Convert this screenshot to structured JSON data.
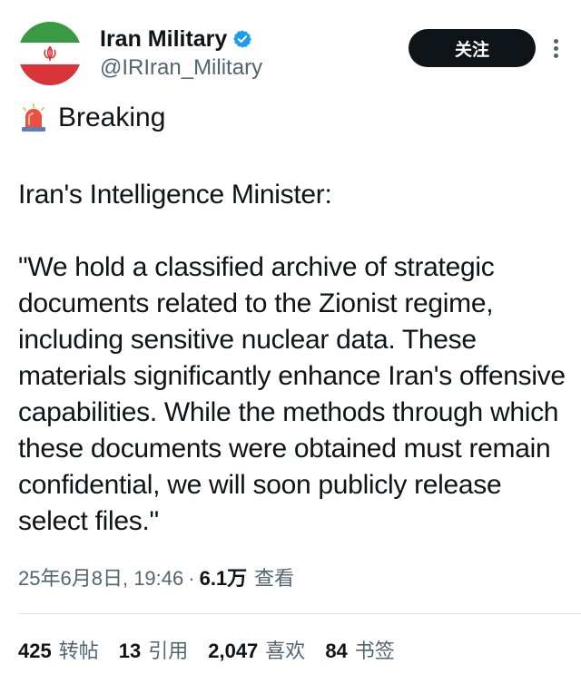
{
  "author": {
    "display_name": "Iran Military",
    "handle": "@IRIran_Military",
    "verified": true,
    "avatar_icon": "iran-flag-avatar"
  },
  "follow_label": "关注",
  "tag": {
    "icon": "rotating-light-icon",
    "text": "Breaking"
  },
  "body": {
    "intro": "Iran's Intelligence Minister:",
    "quote": "\"We hold a classified archive of strategic documents related to the Zionist regime, including sensitive nuclear data. These materials significantly enhance Iran's offensive capabilities. While the methods through which these documents were obtained must remain confidential, we will soon publicly release select files.\""
  },
  "meta": {
    "date": "25年6月8日",
    "time": "19:46",
    "separator": "·",
    "views": "6.1万",
    "views_label": "查看"
  },
  "stats": [
    {
      "num": "425",
      "label": "转帖"
    },
    {
      "num": "13",
      "label": "引用"
    },
    {
      "num": "2,047",
      "label": "喜欢"
    },
    {
      "num": "84",
      "label": "书签"
    }
  ],
  "colors": {
    "text": "#0f1419",
    "secondary": "#536471",
    "verified": "#1d9bf0",
    "button": "#0f1419"
  }
}
